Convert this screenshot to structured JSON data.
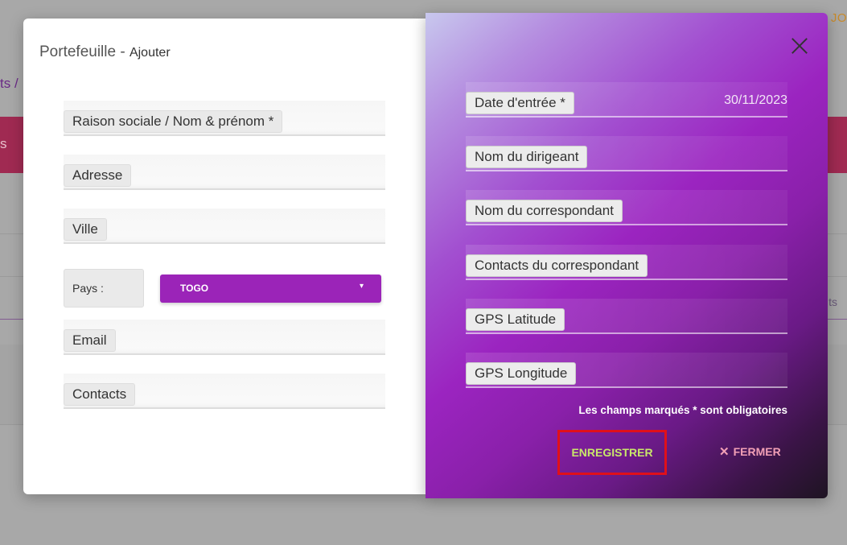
{
  "background": {
    "top_right_text": "JO",
    "breadcrumb_text": "ts /",
    "band_text": "s",
    "side_text": "ts"
  },
  "modal": {
    "title": "Portefeuille - ",
    "subtitle": "Ajouter",
    "left_fields": [
      {
        "label": "Raison sociale / Nom & prénom *"
      },
      {
        "label": "Adresse"
      },
      {
        "label": "Ville"
      },
      {
        "label": "Email"
      },
      {
        "label": "Contacts"
      }
    ],
    "pays": {
      "label": "Pays :",
      "selected": "TOGO",
      "caret": "▾"
    },
    "right_fields": [
      {
        "label": "Date d'entrée *",
        "value": "30/11/2023"
      },
      {
        "label": "Nom du dirigeant"
      },
      {
        "label": "Nom du correspondant"
      },
      {
        "label": "Contacts du correspondant"
      },
      {
        "label": "GPS Latitude"
      },
      {
        "label": "GPS Longitude"
      }
    ],
    "required_note": "Les champs marqués * sont obligatoires",
    "save_label": "ENREGISTRER",
    "close_label": "FERMER",
    "close_glyph": "✕"
  },
  "colors": {
    "accent": "#9b24b8",
    "save_text": "#c9e86a",
    "close_text": "#f2a0b6",
    "highlight_border": "#e0101a"
  },
  "icons": {
    "close": "close-icon",
    "dropdown": "chevron-down-icon"
  }
}
